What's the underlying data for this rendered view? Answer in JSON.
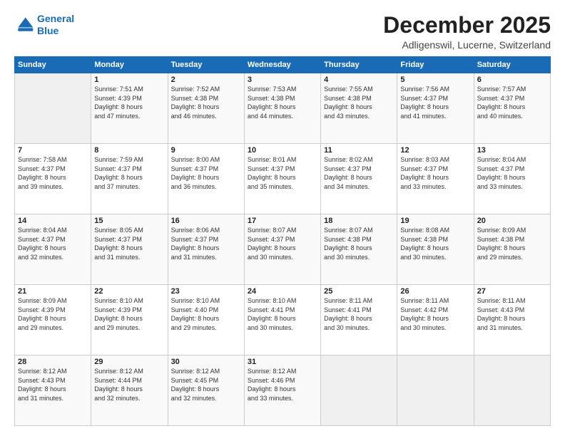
{
  "header": {
    "logo_line1": "General",
    "logo_line2": "Blue",
    "main_title": "December 2025",
    "subtitle": "Adligenswil, Lucerne, Switzerland"
  },
  "days_of_week": [
    "Sunday",
    "Monday",
    "Tuesday",
    "Wednesday",
    "Thursday",
    "Friday",
    "Saturday"
  ],
  "weeks": [
    [
      {
        "day": "",
        "info": ""
      },
      {
        "day": "1",
        "info": "Sunrise: 7:51 AM\nSunset: 4:39 PM\nDaylight: 8 hours\nand 47 minutes."
      },
      {
        "day": "2",
        "info": "Sunrise: 7:52 AM\nSunset: 4:38 PM\nDaylight: 8 hours\nand 46 minutes."
      },
      {
        "day": "3",
        "info": "Sunrise: 7:53 AM\nSunset: 4:38 PM\nDaylight: 8 hours\nand 44 minutes."
      },
      {
        "day": "4",
        "info": "Sunrise: 7:55 AM\nSunset: 4:38 PM\nDaylight: 8 hours\nand 43 minutes."
      },
      {
        "day": "5",
        "info": "Sunrise: 7:56 AM\nSunset: 4:37 PM\nDaylight: 8 hours\nand 41 minutes."
      },
      {
        "day": "6",
        "info": "Sunrise: 7:57 AM\nSunset: 4:37 PM\nDaylight: 8 hours\nand 40 minutes."
      }
    ],
    [
      {
        "day": "7",
        "info": "Sunrise: 7:58 AM\nSunset: 4:37 PM\nDaylight: 8 hours\nand 39 minutes."
      },
      {
        "day": "8",
        "info": "Sunrise: 7:59 AM\nSunset: 4:37 PM\nDaylight: 8 hours\nand 37 minutes."
      },
      {
        "day": "9",
        "info": "Sunrise: 8:00 AM\nSunset: 4:37 PM\nDaylight: 8 hours\nand 36 minutes."
      },
      {
        "day": "10",
        "info": "Sunrise: 8:01 AM\nSunset: 4:37 PM\nDaylight: 8 hours\nand 35 minutes."
      },
      {
        "day": "11",
        "info": "Sunrise: 8:02 AM\nSunset: 4:37 PM\nDaylight: 8 hours\nand 34 minutes."
      },
      {
        "day": "12",
        "info": "Sunrise: 8:03 AM\nSunset: 4:37 PM\nDaylight: 8 hours\nand 33 minutes."
      },
      {
        "day": "13",
        "info": "Sunrise: 8:04 AM\nSunset: 4:37 PM\nDaylight: 8 hours\nand 33 minutes."
      }
    ],
    [
      {
        "day": "14",
        "info": "Sunrise: 8:04 AM\nSunset: 4:37 PM\nDaylight: 8 hours\nand 32 minutes."
      },
      {
        "day": "15",
        "info": "Sunrise: 8:05 AM\nSunset: 4:37 PM\nDaylight: 8 hours\nand 31 minutes."
      },
      {
        "day": "16",
        "info": "Sunrise: 8:06 AM\nSunset: 4:37 PM\nDaylight: 8 hours\nand 31 minutes."
      },
      {
        "day": "17",
        "info": "Sunrise: 8:07 AM\nSunset: 4:37 PM\nDaylight: 8 hours\nand 30 minutes."
      },
      {
        "day": "18",
        "info": "Sunrise: 8:07 AM\nSunset: 4:38 PM\nDaylight: 8 hours\nand 30 minutes."
      },
      {
        "day": "19",
        "info": "Sunrise: 8:08 AM\nSunset: 4:38 PM\nDaylight: 8 hours\nand 30 minutes."
      },
      {
        "day": "20",
        "info": "Sunrise: 8:09 AM\nSunset: 4:38 PM\nDaylight: 8 hours\nand 29 minutes."
      }
    ],
    [
      {
        "day": "21",
        "info": "Sunrise: 8:09 AM\nSunset: 4:39 PM\nDaylight: 8 hours\nand 29 minutes."
      },
      {
        "day": "22",
        "info": "Sunrise: 8:10 AM\nSunset: 4:39 PM\nDaylight: 8 hours\nand 29 minutes."
      },
      {
        "day": "23",
        "info": "Sunrise: 8:10 AM\nSunset: 4:40 PM\nDaylight: 8 hours\nand 29 minutes."
      },
      {
        "day": "24",
        "info": "Sunrise: 8:10 AM\nSunset: 4:41 PM\nDaylight: 8 hours\nand 30 minutes."
      },
      {
        "day": "25",
        "info": "Sunrise: 8:11 AM\nSunset: 4:41 PM\nDaylight: 8 hours\nand 30 minutes."
      },
      {
        "day": "26",
        "info": "Sunrise: 8:11 AM\nSunset: 4:42 PM\nDaylight: 8 hours\nand 30 minutes."
      },
      {
        "day": "27",
        "info": "Sunrise: 8:11 AM\nSunset: 4:43 PM\nDaylight: 8 hours\nand 31 minutes."
      }
    ],
    [
      {
        "day": "28",
        "info": "Sunrise: 8:12 AM\nSunset: 4:43 PM\nDaylight: 8 hours\nand 31 minutes."
      },
      {
        "day": "29",
        "info": "Sunrise: 8:12 AM\nSunset: 4:44 PM\nDaylight: 8 hours\nand 32 minutes."
      },
      {
        "day": "30",
        "info": "Sunrise: 8:12 AM\nSunset: 4:45 PM\nDaylight: 8 hours\nand 32 minutes."
      },
      {
        "day": "31",
        "info": "Sunrise: 8:12 AM\nSunset: 4:46 PM\nDaylight: 8 hours\nand 33 minutes."
      },
      {
        "day": "",
        "info": ""
      },
      {
        "day": "",
        "info": ""
      },
      {
        "day": "",
        "info": ""
      }
    ]
  ]
}
